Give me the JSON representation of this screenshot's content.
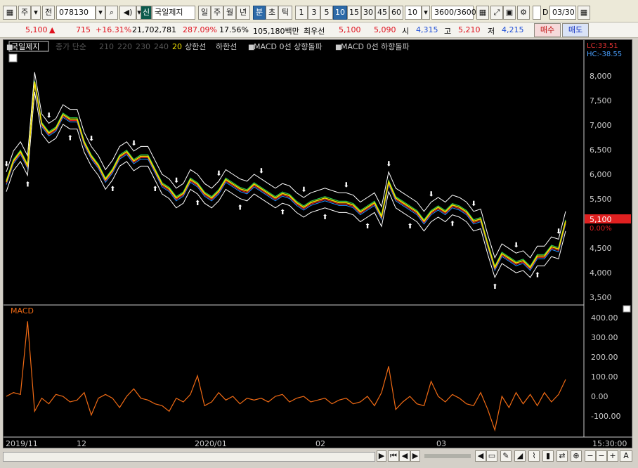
{
  "toolbar": {
    "period_label": "주",
    "prev_label": "전",
    "code": "078130",
    "sin_badge": "신",
    "stock_name": "국일제지",
    "period_tabs": [
      "일",
      "주",
      "월",
      "년"
    ],
    "interval_tabs": [
      "분",
      "초",
      "틱"
    ],
    "interval_values": [
      "1",
      "3",
      "5",
      "10",
      "15",
      "30",
      "45",
      "60"
    ],
    "selected_interval": "10",
    "custom_interval": "10",
    "count": "3600/3600",
    "date_check_label": "D",
    "date_value": "03/30"
  },
  "quote": {
    "price": "5,100",
    "change_arrow": "▲",
    "change": "715",
    "change_pct": "+16.31%",
    "volume": "21,702,781",
    "vol_ratio": "287.09%",
    "turnover": "17.56%",
    "amount": "105,180백만",
    "priority_label": "최우선",
    "ask": "5,100",
    "bid": "5,090",
    "open_label": "시",
    "open": "4,315",
    "high_label": "고",
    "high": "5,210",
    "low_label": "저",
    "low": "4,215",
    "buy_label": "매수",
    "sell_label": "매도"
  },
  "legend": {
    "name": "국일제지",
    "ma_label": "종가 단순",
    "ma_periods": [
      "210",
      "220",
      "230",
      "240",
      "20"
    ],
    "upper": "상한선",
    "lower": "하한선",
    "macd_up": "MACD 0선 상향돌파",
    "macd_down": "MACD 0선 하향돌파",
    "lc": "LC:33.51",
    "hc": "HC:-38.55"
  },
  "price_axis": {
    "labels": [
      "8,000",
      "7,500",
      "7,000",
      "6,500",
      "6,000",
      "5,500",
      "5,000",
      "4,500",
      "4,000",
      "3,500"
    ],
    "current_price": "5,100",
    "current_pct": "0.00%"
  },
  "macd_panel": {
    "title": "MACD",
    "labels": [
      "400.00",
      "300.00",
      "200.00",
      "100.00",
      "0.00",
      "-100.00"
    ]
  },
  "x_axis": {
    "labels": [
      "2019/11",
      "12",
      "2020/01",
      "02",
      "03"
    ],
    "time": "15:30:00"
  },
  "chart_data": {
    "type": "line",
    "series": [
      {
        "values": [
          5950,
          6400,
          6600,
          6300,
          8100,
          7200,
          7000,
          7100,
          7400,
          7300,
          7300,
          6800,
          6500,
          6300,
          6000,
          6200,
          6500,
          6600,
          6400,
          6500,
          6500,
          6200,
          5900,
          5800,
          5600,
          5700,
          6000,
          5900,
          5700,
          5600,
          5750,
          6000,
          5900,
          5800,
          5750,
          5900,
          5800,
          5700,
          5600,
          5700,
          5650,
          5500,
          5400,
          5500,
          5550,
          5600,
          5550,
          5500,
          5500,
          5450,
          5300,
          5400,
          5500,
          5200,
          5950,
          5600,
          5500,
          5400,
          5300,
          5100,
          5300,
          5400,
          5300,
          5450,
          5400,
          5300,
          5100,
          5150,
          4600,
          4100,
          4400,
          4300,
          4200,
          4250,
          4100,
          4350,
          4350,
          4550,
          4500,
          5100
        ]
      }
    ],
    "macd": [
      20,
      40,
      30,
      420,
      -60,
      10,
      -20,
      30,
      20,
      -10,
      0,
      40,
      -80,
      10,
      30,
      10,
      -40,
      20,
      60,
      10,
      0,
      -20,
      -30,
      -60,
      10,
      -10,
      30,
      130,
      -30,
      -10,
      40,
      0,
      20,
      -20,
      10,
      0,
      10,
      -10,
      20,
      30,
      -10,
      10,
      20,
      -10,
      0,
      10,
      -20,
      0,
      10,
      -20,
      -10,
      20,
      -30,
      40,
      180,
      -50,
      -10,
      20,
      -20,
      -30,
      100,
      20,
      -10,
      30,
      10,
      -20,
      -30,
      40,
      -50,
      -160,
      20,
      -40,
      40,
      -20,
      30,
      -30,
      40,
      -10,
      30,
      110
    ],
    "ylim": [
      3400,
      8400
    ],
    "macd_ylim": [
      -160,
      440
    ]
  }
}
